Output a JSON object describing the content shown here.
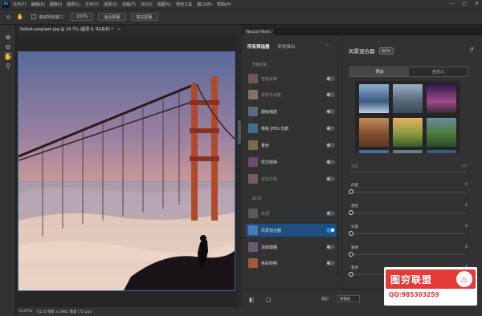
{
  "app": {
    "logo": "Ps"
  },
  "menu": [
    "文件(F)",
    "编辑(E)",
    "图像(I)",
    "图层(L)",
    "文字(Y)",
    "选择(S)",
    "滤镜(T)",
    "3D(D)",
    "视图(V)",
    "增效工具",
    "窗口(W)",
    "帮助(H)"
  ],
  "window_controls": {
    "minimize": "—",
    "maximize": "□",
    "close": "✕"
  },
  "options": {
    "scroll_all": "滚动所有窗口",
    "zoom_100": "100%",
    "fit_screen": "适合屏幕",
    "fill_screen": "填充屏幕"
  },
  "doc": {
    "tab_title": "7eNxA-unsplash.jpg @ 16.7% (图层 0, RGB/8) *",
    "close": "×"
  },
  "status": {
    "zoom": "16.67%",
    "size": "6115 像素 x 3981 像素 (72 ppi)"
  },
  "neural": {
    "tab": "Neural Filters",
    "tabs": {
      "all": "所有筛选器",
      "coming": "即将推出"
    },
    "more": "···",
    "section_featured": "专题内容",
    "section_beta": "BETA",
    "featured": [
      {
        "label": "智能肖像",
        "on": false,
        "dim": true,
        "color": "#6b5a52"
      },
      {
        "label": "皮肤平滑度",
        "on": false,
        "dim": true,
        "color": "#8a7064"
      },
      {
        "label": "超级缩放",
        "on": false,
        "dim": false,
        "color": "#5a6a7a"
      },
      {
        "label": "移除 JPEG 伪影",
        "on": false,
        "dim": false,
        "color": "#3f6e8a"
      },
      {
        "label": "着色",
        "on": false,
        "dim": false,
        "color": "#7a6a4a"
      },
      {
        "label": "样式转换",
        "on": false,
        "dim": false,
        "color": "#6a4a6e"
      },
      {
        "label": "妆容迁移",
        "on": false,
        "dim": true,
        "color": "#7a5a5a"
      }
    ],
    "beta": [
      {
        "label": "协调",
        "on": false,
        "dim": true,
        "color": "#5a5a5a"
      },
      {
        "label": "风景混合器",
        "on": true,
        "dim": false,
        "color": "#4a7ab0"
      },
      {
        "label": "深度模糊",
        "on": false,
        "dim": false,
        "color": "#6a5a70"
      },
      {
        "label": "色彩转移",
        "on": false,
        "dim": false,
        "color": "#a05a3a"
      }
    ],
    "output_label": "输出",
    "output_value": "新图层"
  },
  "landscape": {
    "title": "风景混合器",
    "badge": "BETA",
    "reset_icon": "↺",
    "tabs": [
      "预设",
      "自定义"
    ],
    "presets": [
      "#5a8ab0",
      "#7a9ab8",
      "#4a3a6a",
      "#8a5a3a",
      "#c89040",
      "#3a6a3a",
      "#4a5a7a",
      "#6a6a6a",
      "#3a5a80"
    ],
    "sliders": [
      {
        "label": "强度",
        "value": "100",
        "dim": true
      },
      {
        "label": "白昼",
        "value": "0"
      },
      {
        "label": "夜色",
        "value": "0"
      },
      {
        "label": "日落",
        "value": "0"
      },
      {
        "label": "春季",
        "value": "0"
      },
      {
        "label": "夏季",
        "value": "0"
      }
    ]
  },
  "watermark": {
    "brand": "图穷联盟",
    "qq": "QQ:985303259",
    "logo": "♨"
  },
  "colors": {
    "accent": "#2680eb",
    "selected_row": "#1f4e80",
    "watermark_red": "#e53935"
  }
}
